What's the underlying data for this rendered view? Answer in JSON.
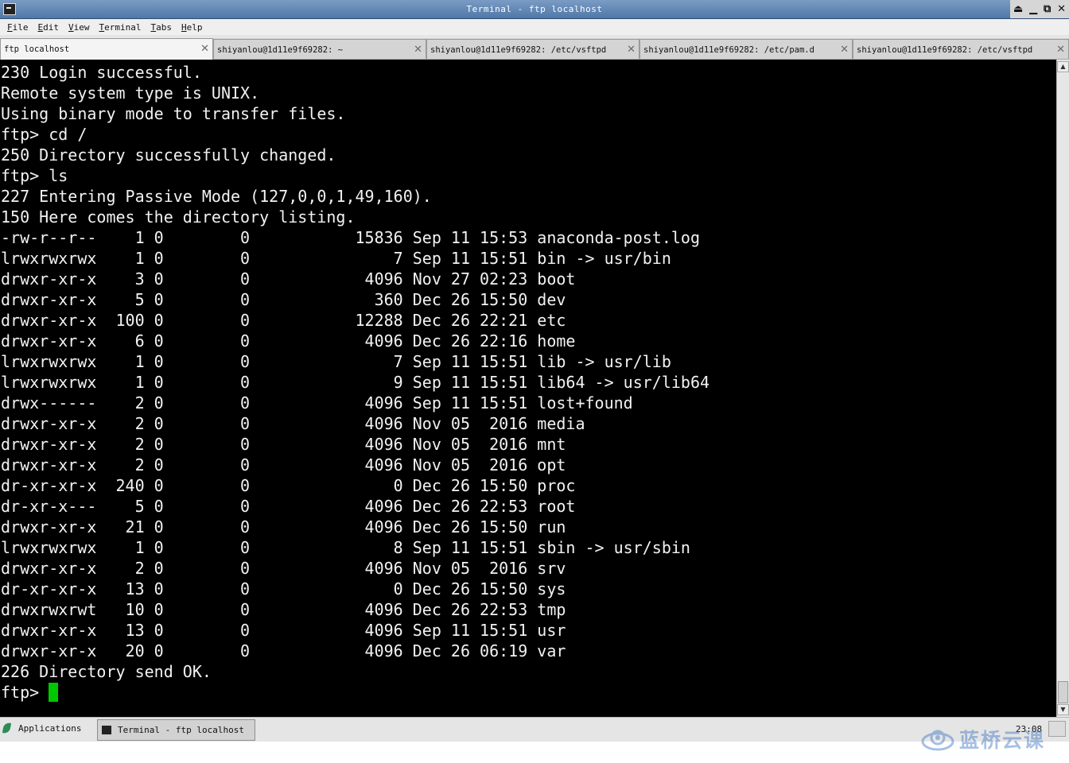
{
  "window": {
    "title": "Terminal - ftp localhost",
    "controls": {
      "shade": "⏏",
      "minimize": "▁",
      "maximize": "⧉",
      "close": "✕"
    }
  },
  "menu": [
    {
      "key": "F",
      "rest": "ile"
    },
    {
      "key": "E",
      "rest": "dit"
    },
    {
      "key": "V",
      "rest": "iew"
    },
    {
      "key": "T",
      "rest": "erminal"
    },
    {
      "key": "T",
      "rest": "abs",
      "first_key_underlined": true
    },
    {
      "key": "H",
      "rest": "elp"
    }
  ],
  "tabs": [
    {
      "label": "ftp localhost",
      "close": "✕",
      "active": true
    },
    {
      "label": "shiyanlou@1d11e9f69282: ~",
      "close": "✕",
      "active": false
    },
    {
      "label": "shiyanlou@1d11e9f69282: /etc/vsftpd",
      "close": "✕",
      "active": false
    },
    {
      "label": "shiyanlou@1d11e9f69282: /etc/pam.d",
      "close": "✕",
      "active": false
    },
    {
      "label": "shiyanlou@1d11e9f69282: /etc/vsftpd",
      "close": "✕",
      "active": false
    }
  ],
  "terminal": {
    "lines": [
      "230 Login successful.",
      "Remote system type is UNIX.",
      "Using binary mode to transfer files.",
      "ftp> cd /",
      "250 Directory successfully changed.",
      "ftp> ls",
      "227 Entering Passive Mode (127,0,0,1,49,160).",
      "150 Here comes the directory listing.",
      "-rw-r--r--    1 0        0           15836 Sep 11 15:53 anaconda-post.log",
      "lrwxrwxrwx    1 0        0               7 Sep 11 15:51 bin -> usr/bin",
      "drwxr-xr-x    3 0        0            4096 Nov 27 02:23 boot",
      "drwxr-xr-x    5 0        0             360 Dec 26 15:50 dev",
      "drwxr-xr-x  100 0        0           12288 Dec 26 22:21 etc",
      "drwxr-xr-x    6 0        0            4096 Dec 26 22:16 home",
      "lrwxrwxrwx    1 0        0               7 Sep 11 15:51 lib -> usr/lib",
      "lrwxrwxrwx    1 0        0               9 Sep 11 15:51 lib64 -> usr/lib64",
      "drwx------    2 0        0            4096 Sep 11 15:51 lost+found",
      "drwxr-xr-x    2 0        0            4096 Nov 05  2016 media",
      "drwxr-xr-x    2 0        0            4096 Nov 05  2016 mnt",
      "drwxr-xr-x    2 0        0            4096 Nov 05  2016 opt",
      "dr-xr-xr-x  240 0        0               0 Dec 26 15:50 proc",
      "dr-xr-x---    5 0        0            4096 Dec 26 22:53 root",
      "drwxr-xr-x   21 0        0            4096 Dec 26 15:50 run",
      "lrwxrwxrwx    1 0        0               8 Sep 11 15:51 sbin -> usr/sbin",
      "drwxr-xr-x    2 0        0            4096 Nov 05  2016 srv",
      "dr-xr-xr-x   13 0        0               0 Dec 26 15:50 sys",
      "drwxrwxrwt   10 0        0            4096 Dec 26 22:53 tmp",
      "drwxr-xr-x   13 0        0            4096 Sep 11 15:51 usr",
      "drwxr-xr-x   20 0        0            4096 Dec 26 06:19 var",
      "226 Directory send OK.",
      "ftp> "
    ],
    "background": "#000000",
    "foreground": "#f2f2f2",
    "cursor_color": "#00c800"
  },
  "scrollbar": {
    "up": "▲",
    "down": "▼"
  },
  "taskbar": {
    "applications_label": "Applications",
    "task_label": "Terminal - ftp localhost",
    "clock": "23:08"
  },
  "watermark": {
    "text": "蓝桥云课",
    "color": "#3d74c2"
  }
}
